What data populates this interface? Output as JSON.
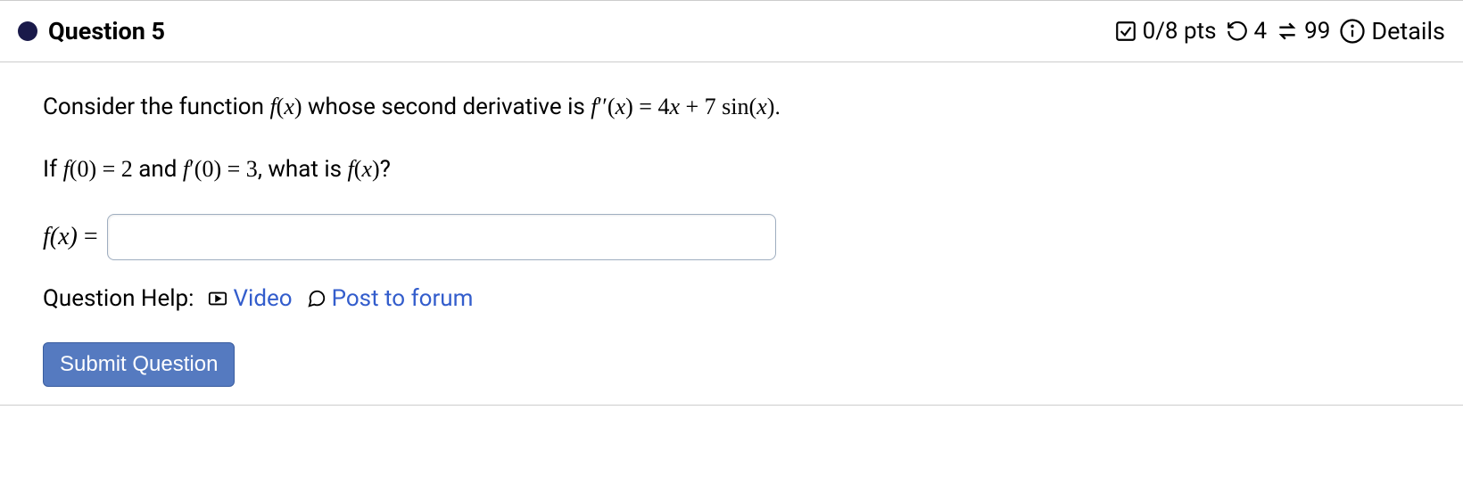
{
  "header": {
    "question_title": "Question 5",
    "points_text": "0/8 pts",
    "attempts_text": "4",
    "retries_text": "99",
    "details_text": "Details"
  },
  "body": {
    "prompt_prefix": "Consider the function ",
    "prompt_f": "f",
    "prompt_x": "x",
    "prompt_mid": " whose second derivative is ",
    "prompt_fpp": "f",
    "prompt_pp_prime": "′′",
    "prompt_eq": " = ",
    "prompt_rhs_4": "4",
    "prompt_rhs_x": "x",
    "prompt_rhs_plus": " + ",
    "prompt_rhs_7": "7 ",
    "prompt_rhs_sin": "sin",
    "prompt_period": ".",
    "line2_prefix": "If ",
    "line2_f": "f",
    "line2_zero": "0",
    "line2_eq2": " = 2",
    "line2_and": " and ",
    "line2_fp": "f",
    "line2_prime": "′",
    "line2_eq3": " = 3",
    "line2_suffix": ", what is ",
    "line2_q": "?",
    "answer_label_f": "f",
    "answer_label_x": "x",
    "answer_equals": " = ",
    "answer_value": ""
  },
  "help": {
    "label": "Question Help:",
    "video_text": "Video",
    "forum_text": "Post to forum"
  },
  "submit": {
    "label": "Submit Question"
  },
  "math_problem": {
    "second_derivative": "f''(x) = 4x + 7 sin(x)",
    "initial_conditions": {
      "f(0)": 2,
      "f'(0)": 3
    },
    "asked_for": "f(x)"
  }
}
